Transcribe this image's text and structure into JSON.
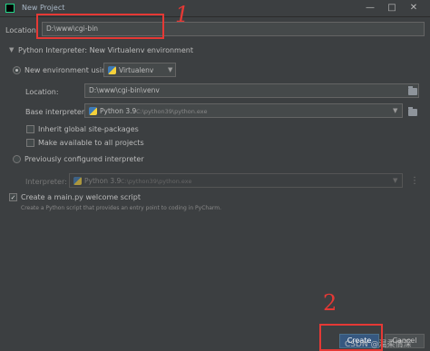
{
  "window": {
    "title": "New Project"
  },
  "location": {
    "label": "Location:",
    "value": "D:\\www\\cgi-bin"
  },
  "interpreter_section": {
    "title": "Python Interpreter: New Virtualenv environment"
  },
  "new_env": {
    "label": "New environment using",
    "tool": "Virtualenv",
    "location_label": "Location:",
    "location_value": "D:\\www\\cgi-bin\\venv",
    "base_label": "Base interpreter:",
    "base_version": "Python 3.9",
    "base_path": "C:\\python39\\python.exe",
    "inherit_label": "Inherit global site-packages",
    "available_label": "Make available to all projects"
  },
  "previous": {
    "label": "Previously configured interpreter",
    "interp_label": "Interpreter:",
    "interp_version": "Python 3.9",
    "interp_path": "C:\\python39\\python.exe"
  },
  "welcome": {
    "label": "Create a main.py welcome script",
    "description": "Create a Python script that provides an entry point to coding in PyCharm."
  },
  "buttons": {
    "create": "Create",
    "cancel": "Cancel"
  },
  "annotations": {
    "mark1": "1",
    "mark2": "2",
    "color": "#e53935"
  },
  "watermark": "CSDN @温柔情深"
}
